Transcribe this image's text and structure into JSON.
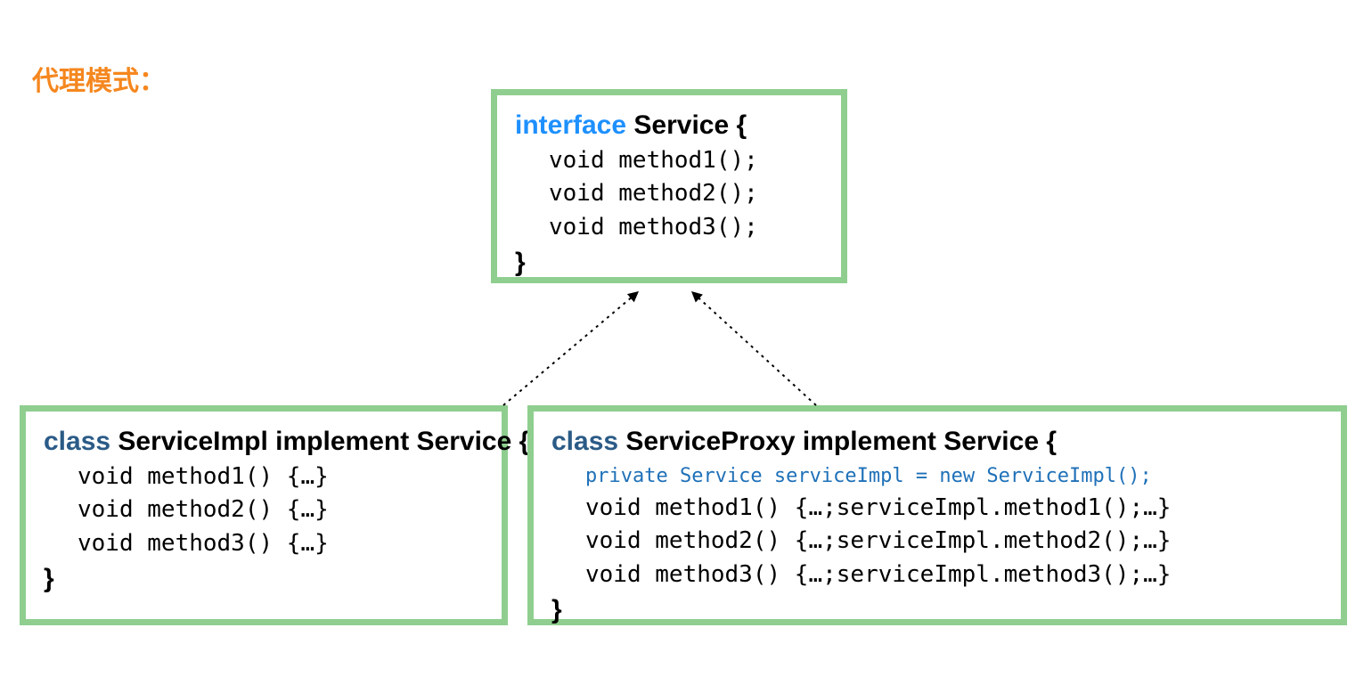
{
  "title": "代理模式：",
  "interface": {
    "keyword": "interface",
    "decl": " Service {",
    "lines": [
      "void method1();",
      "void method2();",
      "void method3();"
    ],
    "close": "}"
  },
  "impl": {
    "keyword": "class",
    "decl": " ServiceImpl implement Service {",
    "lines": [
      "void method1() {…}",
      "void method2() {…}",
      "void method3() {…}"
    ],
    "close": "}"
  },
  "proxy": {
    "keyword": "class",
    "decl": " ServiceProxy implement Service {",
    "field": "private Service serviceImpl = new ServiceImpl();",
    "lines": [
      "void method1() {…;serviceImpl.method1();…}",
      "void method2() {…;serviceImpl.method2();…}",
      "void method3() {…;serviceImpl.method3();…}"
    ],
    "close": "}"
  }
}
